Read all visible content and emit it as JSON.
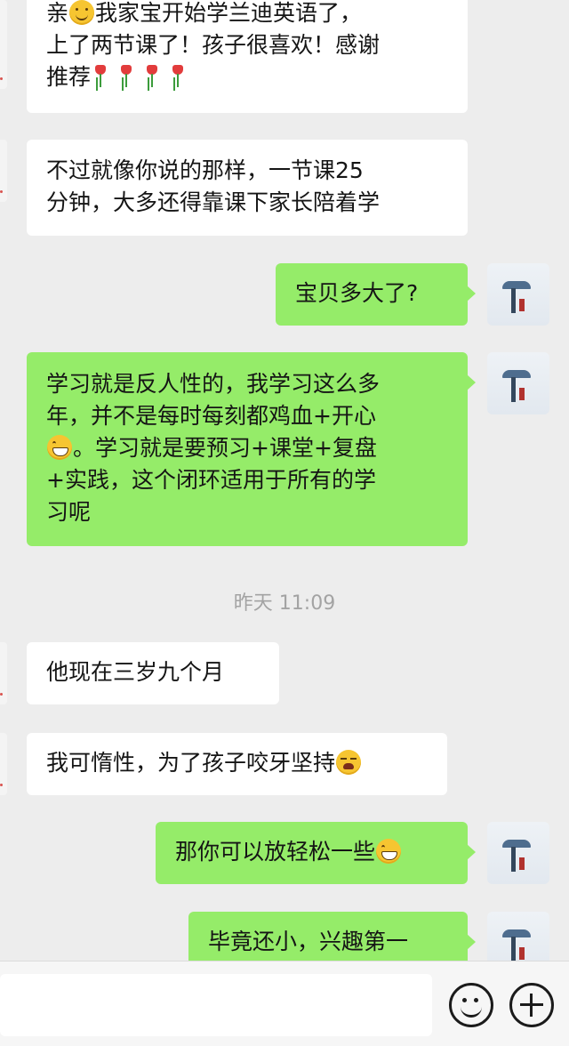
{
  "messages": [
    {
      "id": "m1",
      "lines": [
        "亲",
        "我家宝开始学兰迪英语了，",
        "上了两节课了！孩子很喜欢！感谢",
        "推荐"
      ],
      "emoji": "smile"
    },
    {
      "id": "m2",
      "lines": [
        "不过就像你说的那样，一节课25",
        "分钟，大多还得靠课下家长陪着学"
      ]
    },
    {
      "id": "m3",
      "text": "宝贝多大了?"
    },
    {
      "id": "m4",
      "lines": [
        "学习就是反人性的，我学习这么多",
        "年，并不是每时每刻都鸡血+开心",
        "。学习就是要预习+课堂+复盘",
        "+实践，这个闭环适用于所有的学",
        "习呢"
      ],
      "emoji": "grin"
    },
    {
      "id": "m5",
      "text": "他现在三岁九个月"
    },
    {
      "id": "m6",
      "text": "我可惰性，为了孩子咬牙坚持",
      "emoji": "cry"
    },
    {
      "id": "m7",
      "text": "那你可以放轻松一些",
      "emoji": "grin"
    },
    {
      "id": "m8",
      "text": "毕竟还小，兴趣第一"
    }
  ],
  "timestamp": "昨天 11:09",
  "icons": {
    "emoji_button": "smiley-face-icon",
    "plus_button": "plus-circle-icon",
    "rose": "rose-icon"
  },
  "colors": {
    "outgoing_bubble": "#95ec69",
    "incoming_bubble": "#ffffff",
    "background": "#ededed"
  }
}
